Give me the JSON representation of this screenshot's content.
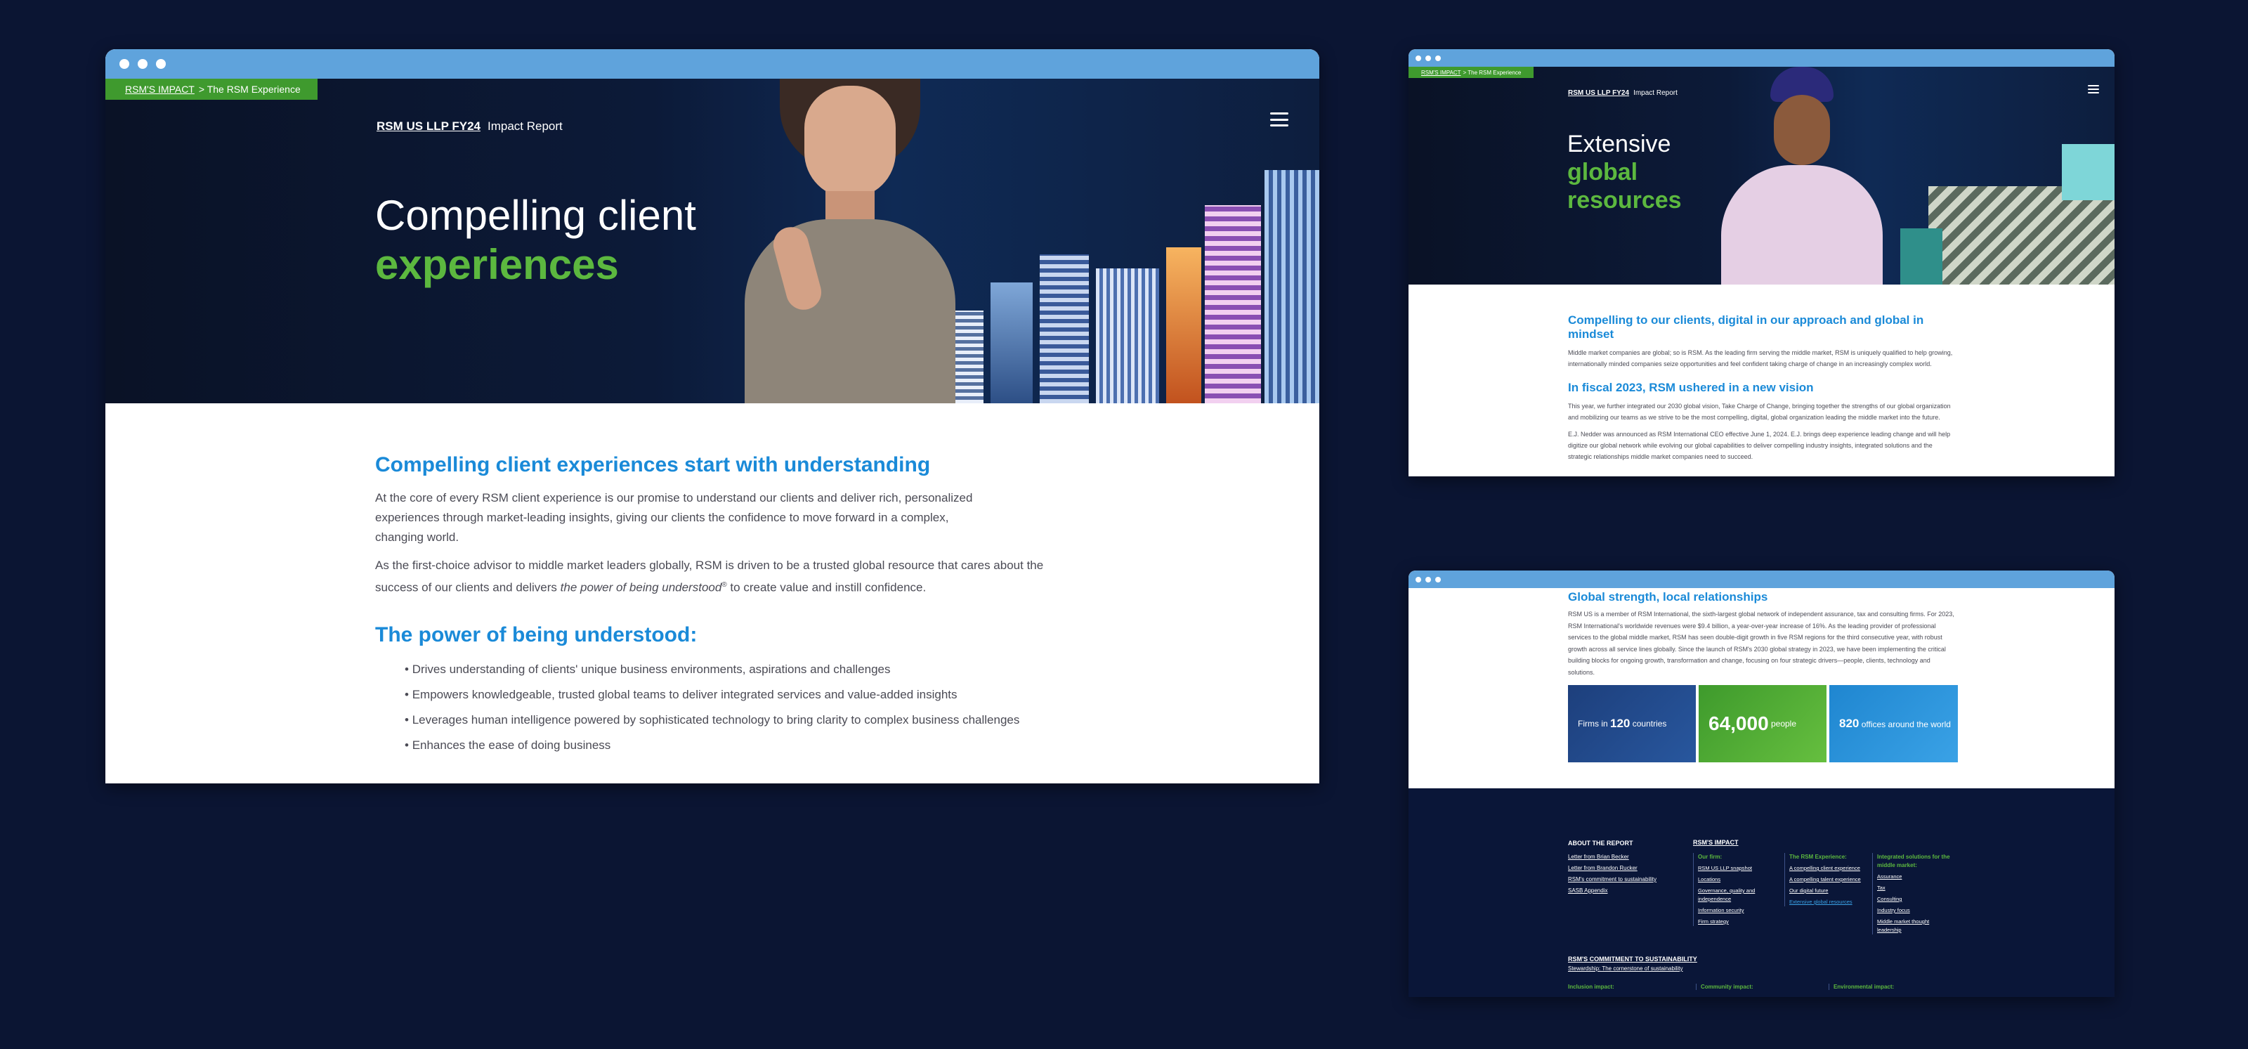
{
  "colors": {
    "accent_green": "#5cb83f",
    "accent_blue": "#1a8ad8",
    "chrome": "#5fa3dc",
    "background": "#0b1533"
  },
  "w1": {
    "breadcrumb_link": "RSM'S IMPACT",
    "breadcrumb_rest": "> The RSM Experience",
    "brand_name": "RSM US LLP FY24",
    "brand_sub": "Impact Report",
    "hero_line1": "Compelling client",
    "hero_line2": "experiences",
    "h2_a": "Compelling client experiences start with understanding",
    "p1": "At the core of every RSM client experience is our promise to understand our clients and deliver rich, personalized experiences through market-leading insights, giving our clients the confidence to move forward in a complex, changing  world.",
    "p2_a": "As the first-choice advisor to middle market leaders globally, RSM is driven to be a trusted global resource that cares about the success of our clients and delivers",
    "p2_em": "the power of being understood",
    "p2_sup": "®",
    "p2_b": "to create value and instill confidence.",
    "h2_b": "The power of being understood:",
    "bullets": [
      "Drives understanding of clients' unique business environments, aspirations and challenges",
      "Empowers knowledgeable, trusted global teams to deliver integrated services and value-added insights",
      "Leverages human intelligence powered by sophisticated technology to bring clarity to complex business challenges",
      "Enhances the ease of doing business"
    ]
  },
  "w2": {
    "breadcrumb_link": "RSM'S IMPACT",
    "breadcrumb_rest": "> The RSM Experience",
    "brand_name": "RSM US LLP FY24",
    "brand_sub": "Impact Report",
    "hero_line1": "Extensive",
    "hero_line2": "global",
    "hero_line3": "resources",
    "h3_a": "Compelling to our clients, digital in our approach and global in mindset",
    "p1": "Middle market companies are global; so is RSM. As the leading firm serving the middle market, RSM is uniquely qualified to help growing, internationally minded companies seize opportunities and feel confident taking charge of change in an increasingly complex world.",
    "h3_b": "In fiscal 2023, RSM ushered in a new vision",
    "p2": "This year, we further integrated our 2030 global vision, Take Charge of Change, bringing together the strengths of our global organization and mobilizing our teams as we strive to be the most compelling, digital, global organization leading the middle market into the future.",
    "p3": "E.J. Nedder was announced as RSM International CEO effective June 1, 2024. E.J. brings deep experience leading change and will help digitize our global network while evolving our global capabilities to deliver compelling industry insights, integrated solutions and the strategic relationships middle market companies need to succeed."
  },
  "w3": {
    "h3": "Global strength, local relationships",
    "p": "RSM US is a member of RSM International, the sixth-largest global network of independent assurance, tax and consulting firms. For 2023, RSM International's worldwide revenues were $9.4 billion, a year-over-year increase of 16%. As the leading provider of professional services to the global middle market, RSM has seen double-digit growth in five RSM regions for the third consecutive year, with robust growth across all service lines globally. Since the launch of RSM's 2030 global strategy in 2023, we have been implementing the critical building blocks for ongoing growth, transformation and change, focusing on four strategic drivers—people, clients, technology and solutions.",
    "stat1_pre": "Firms in",
    "stat1_num": "120",
    "stat1_post": "countries",
    "stat2_num": "64,000",
    "stat2_post": "people",
    "stat3_num": "820",
    "stat3_post": "offices around the world",
    "footer": {
      "about_title": "ABOUT THE REPORT",
      "about_links": [
        "Letter from Brian Becker",
        "Letter from Brandon Rucker",
        "RSM's commitment to sustainability",
        "SASB Appendix"
      ],
      "impact_title": "RSM'S IMPACT",
      "ourfirm_title": "Our firm:",
      "ourfirm_links": [
        "RSM US LLP snapshot",
        "Locations",
        "Governance, quality and independence",
        "Information security",
        "Firm strategy"
      ],
      "exp_title": "The RSM Experience:",
      "exp_links": [
        "A compelling client experience",
        "A compelling talent experience",
        "Our digital future"
      ],
      "exp_active": "Extensive global resources",
      "int_title": "Integrated solutions for the middle market:",
      "int_links": [
        "Assurance",
        "Tax",
        "Consulting",
        "Industry focus",
        "Middle market thought leadership"
      ],
      "sust_title": "RSM'S COMMITMENT TO SUSTAINABILITY",
      "sust_link": "Stewardship: The cornerstone of sustainability",
      "bottom": [
        "Inclusion impact:",
        "Community impact:",
        "Environmental impact:"
      ]
    }
  }
}
